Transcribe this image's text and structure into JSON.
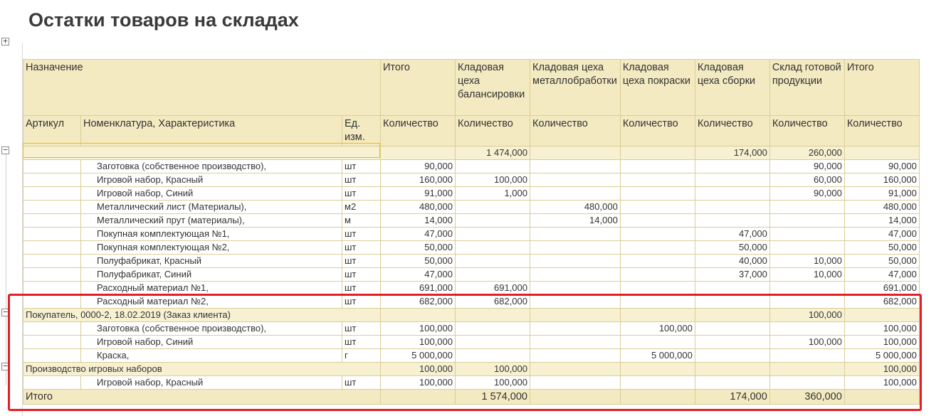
{
  "title": "Остатки товаров на складах",
  "header1": {
    "purpose": "Назначение",
    "columns": [
      "Итого",
      "Кладовая цеха балансировки",
      "Кладовая цеха металлобработки",
      "Кладовая цеха покраски",
      "Кладовая цеха сборки",
      "Склад готовой продукции",
      "Итого"
    ]
  },
  "header2": {
    "article": "Артикул",
    "item": "Номенклатура, Характеристика",
    "unit": "Ед. изм.",
    "qty": [
      "Количество",
      "Количество",
      "Количество",
      "Количество",
      "Количество",
      "Количество",
      "Количество"
    ]
  },
  "rows": [
    {
      "type": "group",
      "label": "",
      "values": [
        "",
        "1 474,000",
        "",
        "",
        "174,000",
        "260,000",
        ""
      ]
    },
    {
      "type": "detail",
      "label": "Заготовка (собственное производство),",
      "unit": "шт",
      "values": [
        "90,000",
        "",
        "",
        "",
        "",
        "90,000",
        "90,000"
      ]
    },
    {
      "type": "detail",
      "label": "Игровой набор, Красный",
      "unit": "шт",
      "values": [
        "160,000",
        "100,000",
        "",
        "",
        "",
        "60,000",
        "160,000"
      ]
    },
    {
      "type": "detail",
      "label": "Игровой набор, Синий",
      "unit": "шт",
      "values": [
        "91,000",
        "1,000",
        "",
        "",
        "",
        "90,000",
        "91,000"
      ]
    },
    {
      "type": "detail",
      "label": "Металлический лист (Материалы),",
      "unit": "м2",
      "values": [
        "480,000",
        "",
        "480,000",
        "",
        "",
        "",
        "480,000"
      ]
    },
    {
      "type": "detail",
      "label": "Металлический прут (материалы),",
      "unit": "м",
      "values": [
        "14,000",
        "",
        "14,000",
        "",
        "",
        "",
        "14,000"
      ]
    },
    {
      "type": "detail",
      "label": "Покупная комплектующая №1,",
      "unit": "шт",
      "values": [
        "47,000",
        "",
        "",
        "",
        "47,000",
        "",
        "47,000"
      ]
    },
    {
      "type": "detail",
      "label": "Покупная комплектующая №2,",
      "unit": "шт",
      "values": [
        "50,000",
        "",
        "",
        "",
        "50,000",
        "",
        "50,000"
      ]
    },
    {
      "type": "detail",
      "label": "Полуфабрикат, Красный",
      "unit": "шт",
      "values": [
        "50,000",
        "",
        "",
        "",
        "40,000",
        "10,000",
        "50,000"
      ]
    },
    {
      "type": "detail",
      "label": "Полуфабрикат, Синий",
      "unit": "шт",
      "values": [
        "47,000",
        "",
        "",
        "",
        "37,000",
        "10,000",
        "47,000"
      ]
    },
    {
      "type": "detail",
      "label": "Расходный материал №1,",
      "unit": "шт",
      "values": [
        "691,000",
        "691,000",
        "",
        "",
        "",
        "",
        "691,000"
      ]
    },
    {
      "type": "detail",
      "label": "Расходный материал №2,",
      "unit": "шт",
      "values": [
        "682,000",
        "682,000",
        "",
        "",
        "",
        "",
        "682,000"
      ]
    },
    {
      "type": "group",
      "label": "Покупатель, 0000-2, 18.02.2019 (Заказ клиента)",
      "values": [
        "",
        "",
        "",
        "",
        "",
        "100,000",
        ""
      ]
    },
    {
      "type": "detail",
      "label": "Заготовка (собственное производство),",
      "unit": "шт",
      "values": [
        "100,000",
        "",
        "",
        "100,000",
        "",
        "",
        "100,000"
      ]
    },
    {
      "type": "detail",
      "label": "Игровой набор, Синий",
      "unit": "шт",
      "values": [
        "100,000",
        "",
        "",
        "",
        "",
        "100,000",
        "100,000"
      ]
    },
    {
      "type": "detail",
      "label": "Краска,",
      "unit": "г",
      "values": [
        "5 000,000",
        "",
        "",
        "5 000,000",
        "",
        "",
        "5 000,000"
      ]
    },
    {
      "type": "group",
      "label": "Производство игровых наборов",
      "values": [
        "100,000",
        "100,000",
        "",
        "",
        "",
        "",
        "100,000"
      ]
    },
    {
      "type": "detail",
      "label": "Игровой набор, Красный",
      "unit": "шт",
      "values": [
        "100,000",
        "100,000",
        "",
        "",
        "",
        "",
        "100,000"
      ]
    }
  ],
  "total": {
    "label": "Итого",
    "values": [
      "",
      "1 574,000",
      "",
      "",
      "174,000",
      "360,000",
      ""
    ]
  },
  "tree_buttons": {
    "top": "+",
    "groups": [
      "−",
      "−",
      "−"
    ]
  },
  "colors": {
    "header_bg": "#f3eac1",
    "group_bg": "#f7f1d2",
    "border": "#d9cd97",
    "highlight": "#e31f26",
    "selection": "#f0c000"
  }
}
